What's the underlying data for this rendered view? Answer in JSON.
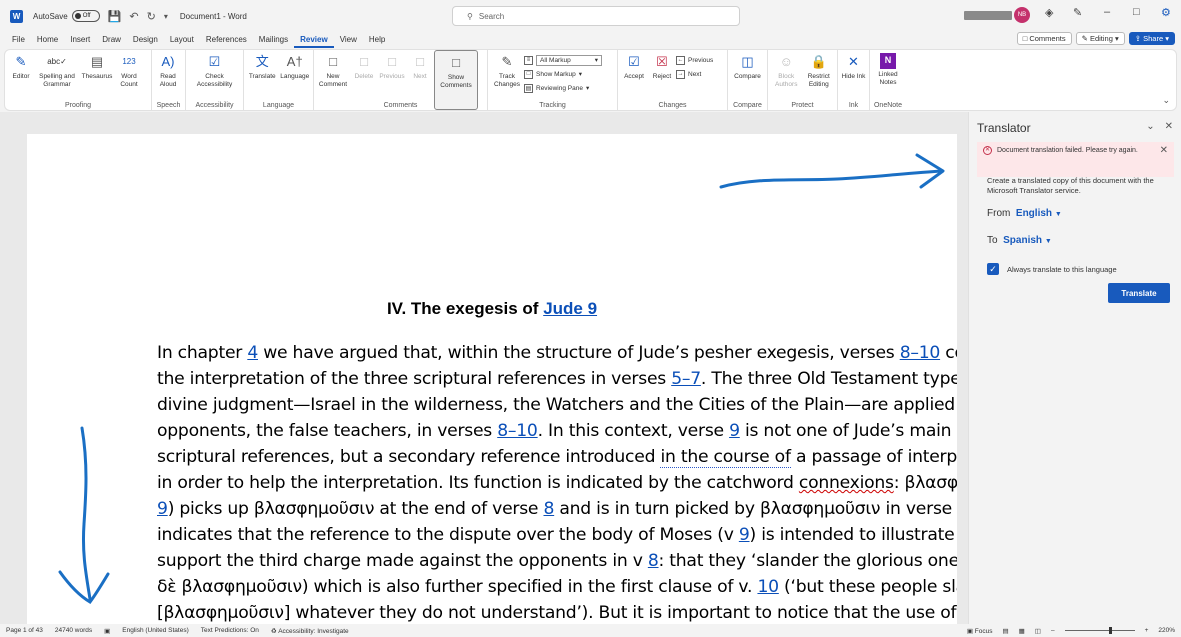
{
  "app": {
    "autosave_label": "AutoSave",
    "autosave_state": "Off",
    "doc_title": "Document1 - Word",
    "search_placeholder": "Search",
    "avatar_initials": "NB"
  },
  "menu": {
    "tabs": [
      "File",
      "Home",
      "Insert",
      "Draw",
      "Design",
      "Layout",
      "References",
      "Mailings",
      "Review",
      "View",
      "Help"
    ],
    "active": "Review"
  },
  "ribbon_right": {
    "comments": "Comments",
    "editing": "Editing",
    "share": "Share"
  },
  "ribbon": {
    "proofing": {
      "label": "Proofing",
      "editor": "Editor",
      "spelling": "Spelling and Grammar",
      "thesaurus": "Thesaurus",
      "word_count": "Word Count"
    },
    "speech": {
      "label": "Speech",
      "read_aloud": "Read Aloud"
    },
    "accessibility": {
      "label": "Accessibility",
      "check": "Check Accessibility"
    },
    "language": {
      "label": "Language",
      "translate": "Translate",
      "language": "Language"
    },
    "comments": {
      "label": "Comments",
      "new": "New Comment",
      "delete": "Delete",
      "previous": "Previous",
      "next": "Next",
      "show": "Show Comments"
    },
    "tracking": {
      "label": "Tracking",
      "track": "Track Changes",
      "markup_select": "All Markup",
      "show_markup": "Show Markup",
      "reviewing_pane": "Reviewing Pane"
    },
    "changes": {
      "label": "Changes",
      "accept": "Accept",
      "reject": "Reject",
      "previous": "Previous",
      "next": "Next"
    },
    "compare": {
      "label": "Compare",
      "compare": "Compare"
    },
    "protect": {
      "label": "Protect",
      "block": "Block Authors",
      "restrict": "Restrict Editing"
    },
    "ink": {
      "label": "Ink",
      "hide": "Hide Ink"
    },
    "onenote": {
      "label": "OneNote",
      "linked": "Linked Notes"
    }
  },
  "document": {
    "heading_prefix": "IV. The exegesis of ",
    "heading_link": "Jude 9",
    "lines": [
      {
        "a": "In chapter ",
        "l1": "4",
        "b": " we have argued that, within the structure of Jude’s pesher exegesis, verses ",
        "l2": "8–10",
        "c": " constit"
      },
      {
        "a": "the interpretation of the three scriptural references in verses ",
        "l1": "5–7",
        "b": ". The three Old Testament types of"
      },
      {
        "a": "divine judgment—Israel in the wilderness, the Watchers and the Cities of the Plain—are applied to J"
      },
      {
        "a": "opponents, the false teachers, in verses ",
        "l1": "8–10",
        "b": ". In this context, verse ",
        "l2": "9",
        "c": " is not one of Jude’s main serie"
      },
      {
        "a": "scriptural references, but a secondary reference introduced ",
        "u": "in the course of",
        "b": " a passage of interpretat"
      },
      {
        "a": "in order to help the interpretation. Its function is indicated by the catchword ",
        "r": "connexions",
        "b": ": βλασφημ"
      },
      {
        "l0": "9",
        "a": ") picks up βλασφημοῦσιν at the end of verse ",
        "l1": "8",
        "b": " and is in turn picked by βλασφημοῦσιν in verse ",
        "l2": "10"
      },
      {
        "a": "indicates that the reference to the dispute over the body of Moses (v ",
        "l1": "9",
        "b": ") is intended to illustrate or to"
      },
      {
        "a": "support the third charge made against the opponents in v ",
        "l1": "8",
        "b": ": that they ‘slander the glorious ones’ (δ"
      },
      {
        "a": "δὲ βλασφημοῦσιν) which is also further specified in the first clause of v. ",
        "l1": "10",
        "b": " (‘but these people slanc"
      },
      {
        "a": "[βλασφημοῦσιν] whatever they do not understand’). But it is important to notice that the use of"
      }
    ]
  },
  "translator": {
    "title": "Translator",
    "error": "Document translation failed. Please try again.",
    "description": "Create a translated copy of this document with the Microsoft Translator service.",
    "from_label": "From",
    "from_value": "English",
    "to_label": "To",
    "to_value": "Spanish",
    "always_label": "Always translate to this language",
    "button": "Translate"
  },
  "status": {
    "page": "Page 1 of 43",
    "words": "24740 words",
    "language": "English (United States)",
    "predictions": "Text Predictions: On",
    "accessibility": "Accessibility: Investigate",
    "focus": "Focus",
    "zoom": "220%"
  },
  "colors": {
    "accent": "#185abd",
    "ink": "#1a6fc4",
    "error_bg": "#fde7e9"
  }
}
